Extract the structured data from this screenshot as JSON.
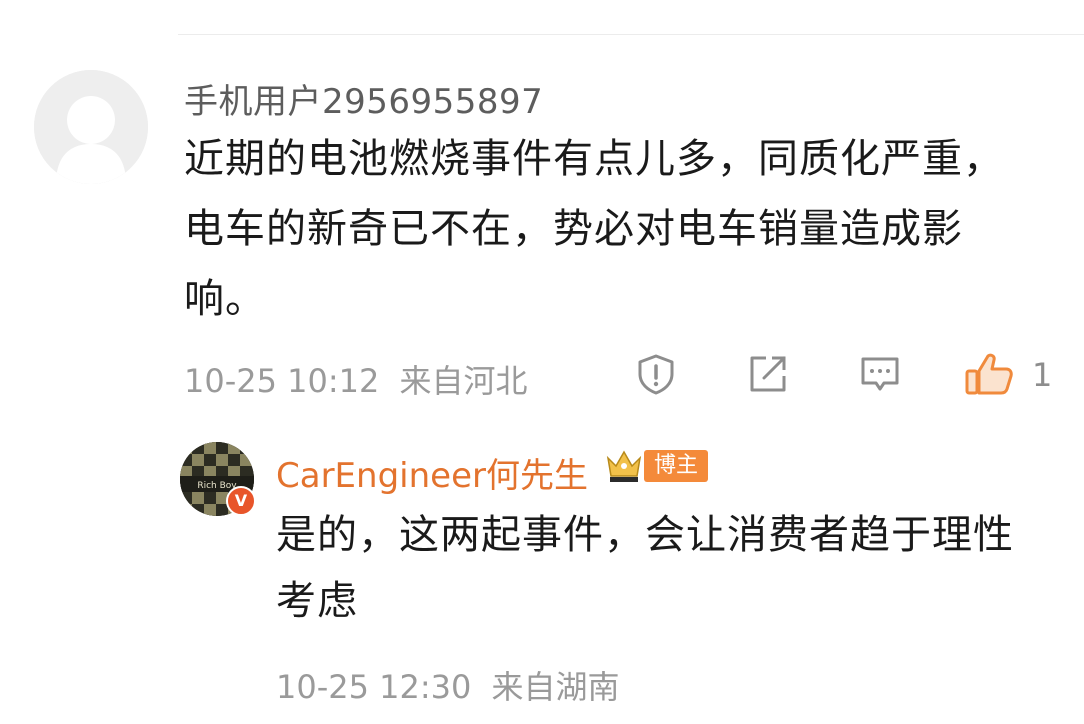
{
  "comment": {
    "username": "手机用户2956955897",
    "text": "近期的电池燃烧事件有点儿多，同质化严重，电车的新奇已不在，势必对电车销量造成影响。",
    "timestamp": "10-25 10:12",
    "location": "来自河北",
    "like_count": "1",
    "actions": [
      "report-icon",
      "share-icon",
      "comment-icon",
      "like-icon"
    ],
    "accent_color": "#f08a3c"
  },
  "reply": {
    "username": "CarEngineer何先生",
    "avatar_text": "Rich Boy",
    "verified_mark": "V",
    "badge": "博主",
    "text": "是的，这两起事件，会让消费者趋于理性考虑",
    "timestamp": "10-25 12:30",
    "location": "来自湖南",
    "name_color": "#e3732e"
  }
}
